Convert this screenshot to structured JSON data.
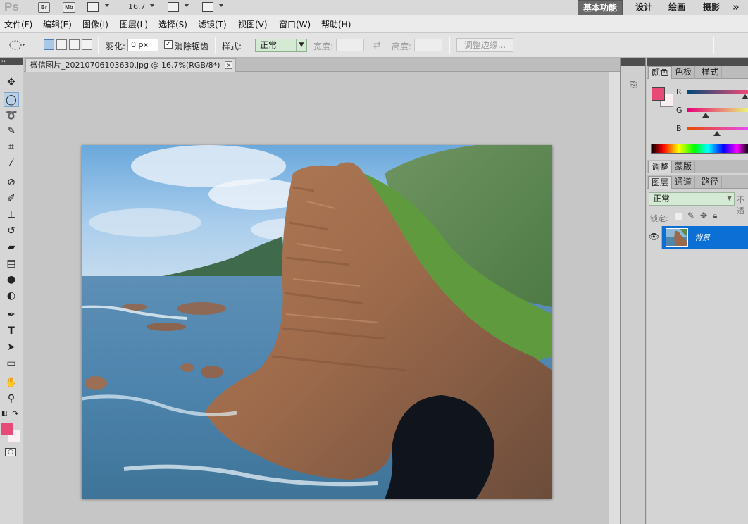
{
  "app": {
    "logo": "Ps",
    "bridge_label": "Br",
    "minibridge_label": "Mb",
    "zoom": "16.7"
  },
  "workspaces": {
    "basic": "基本功能",
    "design": "设计",
    "painting": "绘画",
    "photography": "摄影",
    "more": "»"
  },
  "menu": [
    "文件(F)",
    "编辑(E)",
    "图像(I)",
    "图层(L)",
    "选择(S)",
    "滤镜(T)",
    "视图(V)",
    "窗口(W)",
    "帮助(H)"
  ],
  "options": {
    "feather_label": "羽化:",
    "feather_value": "0 px",
    "antialias_label": "消除锯齿",
    "antialias_checked": true,
    "style_label": "样式:",
    "style_value": "正常",
    "swap_icon": "⇄",
    "width_label": "宽度:",
    "height_label": "高度:",
    "refine_edge_label": "调整边缘..."
  },
  "document": {
    "tab_title": "微信图片_20210706103630.jpg @ 16.7%(RGB/8*)",
    "close_symbol": "×"
  },
  "tools": [
    "move-icon",
    "elliptical-marquee-icon",
    "lasso-icon",
    "quick-select-icon",
    "crop-icon",
    "eyedropper-icon",
    "healing-brush-icon",
    "brush-icon",
    "clone-stamp-icon",
    "history-brush-icon",
    "eraser-icon",
    "gradient-icon",
    "blur-icon",
    "dodge-icon",
    "pen-icon",
    "type-icon",
    "path-select-icon",
    "rectangle-icon",
    "hand-icon",
    "zoom-icon"
  ],
  "colors": {
    "foreground": "#e84a77",
    "background": "#faf0f2",
    "layer_selected": "#0b6fd6",
    "style_select": "#d4ead4"
  },
  "color_panel": {
    "tabs": [
      "颜色",
      "色板",
      "样式"
    ],
    "channels": [
      {
        "label": "R",
        "value": 232
      },
      {
        "label": "G",
        "value": 74
      },
      {
        "label": "B",
        "value": 119
      }
    ]
  },
  "adjust_panel": {
    "tabs": [
      "调整",
      "蒙版"
    ]
  },
  "layers_panel": {
    "tabs": [
      "图层",
      "通道",
      "路径"
    ],
    "blend_mode": "正常",
    "opacity_label": "不透",
    "lock_label": "锁定:",
    "layer_name": "背景"
  }
}
